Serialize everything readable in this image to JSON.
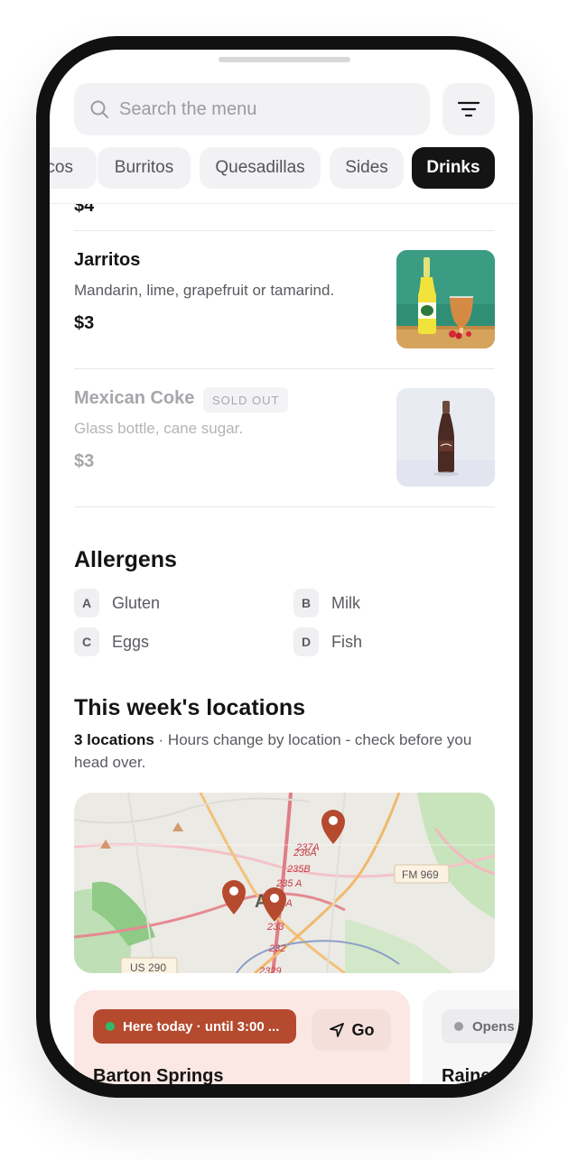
{
  "search": {
    "placeholder": "Search the menu"
  },
  "filter": {
    "icon": "filter-icon"
  },
  "categories": {
    "items": [
      "cos",
      "Burritos",
      "Quesadillas",
      "Sides",
      "Drinks"
    ],
    "active": "Drinks"
  },
  "cut_item": {
    "price": "$4"
  },
  "menu": {
    "items": [
      {
        "name": "Jarritos",
        "description": "Mandarin, lime, grapefruit or tamarind.",
        "price": "$3",
        "sold_out": false
      },
      {
        "name": "Mexican Coke",
        "badge": "SOLD OUT",
        "description": "Glass bottle, cane sugar.",
        "price": "$3",
        "sold_out": true
      }
    ]
  },
  "allergens": {
    "title": "Allergens",
    "items": [
      {
        "key": "A",
        "name": "Gluten"
      },
      {
        "key": "B",
        "name": "Milk"
      },
      {
        "key": "C",
        "name": "Eggs"
      },
      {
        "key": "D",
        "name": "Fish"
      }
    ]
  },
  "locations": {
    "title": "This week's locations",
    "count": "3 locations",
    "separator": " · ",
    "note": "Hours change by location - check before you head over.",
    "map_labels": [
      "237A",
      "236A",
      "235B",
      "235 A",
      "234A",
      "233",
      "232",
      "2329",
      "FM 969",
      "US 290",
      "Au"
    ],
    "cards": [
      {
        "status": "Here today · until 3:00 ...",
        "go_label": "Go",
        "name": "Barton Springs"
      },
      {
        "status": "Opens",
        "name": "Rainey"
      }
    ]
  },
  "colors": {
    "accent": "#b54a2f",
    "active_chip": "#141414",
    "open_dot": "#2fb96a",
    "card_bg": "#fbe8e4"
  }
}
